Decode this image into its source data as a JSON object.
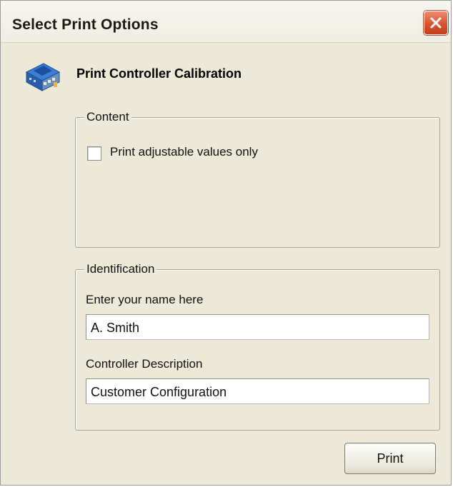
{
  "window": {
    "title": "Select Print Options",
    "close_icon": "close-x-icon"
  },
  "header": {
    "icon": "controller-chip-icon",
    "title": "Print Controller Calibration"
  },
  "content_group": {
    "legend": "Content",
    "checkbox": {
      "label": "Print adjustable values only",
      "checked": false
    }
  },
  "identification_group": {
    "legend": "Identification",
    "name_label": "Enter your name here",
    "name_value": "A. Smith",
    "description_label": "Controller Description",
    "description_value": "Customer Configuration"
  },
  "actions": {
    "print_label": "Print"
  },
  "colors": {
    "window_bg": "#ece9d8",
    "close_button": "#d9542e"
  }
}
